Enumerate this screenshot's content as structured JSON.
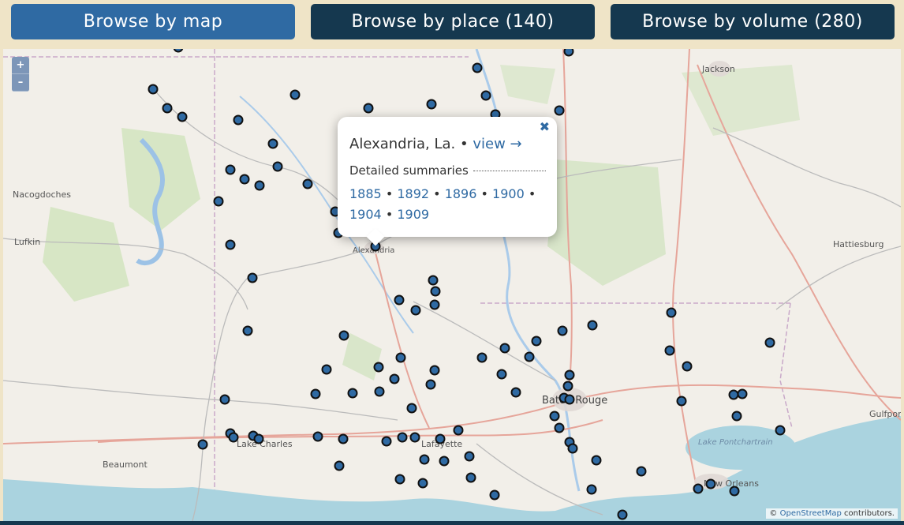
{
  "tabs": [
    {
      "label": "Browse by map"
    },
    {
      "label": "Browse by place (140)"
    },
    {
      "label": "Browse by volume (280)"
    }
  ],
  "zoom": {
    "in_label": "+",
    "out_label": "–"
  },
  "map_labels": [
    {
      "text": "Jackson",
      "kind": "city"
    },
    {
      "text": "Nacogdoches",
      "kind": "city"
    },
    {
      "text": "Lufkin",
      "kind": "city"
    },
    {
      "text": "Alexandria",
      "kind": "city"
    },
    {
      "text": "Hattiesburg",
      "kind": "city"
    },
    {
      "text": "Baton Rouge",
      "kind": "city-large"
    },
    {
      "text": "Gulfport",
      "kind": "city"
    },
    {
      "text": "Lake Charles",
      "kind": "city"
    },
    {
      "text": "Lafayette",
      "kind": "city"
    },
    {
      "text": "Beaumont",
      "kind": "city"
    },
    {
      "text": "Lake Pontchartrain",
      "kind": "water"
    },
    {
      "text": "New Orleans",
      "kind": "city"
    }
  ],
  "popup": {
    "place": "Alexandria, La.",
    "separator": "•",
    "view_label": "view →",
    "close_label": "✖",
    "section_title": "Detailed summaries",
    "years": [
      "1885",
      "1892",
      "1896",
      "1900",
      "1904",
      "1909"
    ]
  },
  "attribution": {
    "prefix": "©",
    "link": "OpenStreetMap",
    "suffix": "contributors."
  }
}
